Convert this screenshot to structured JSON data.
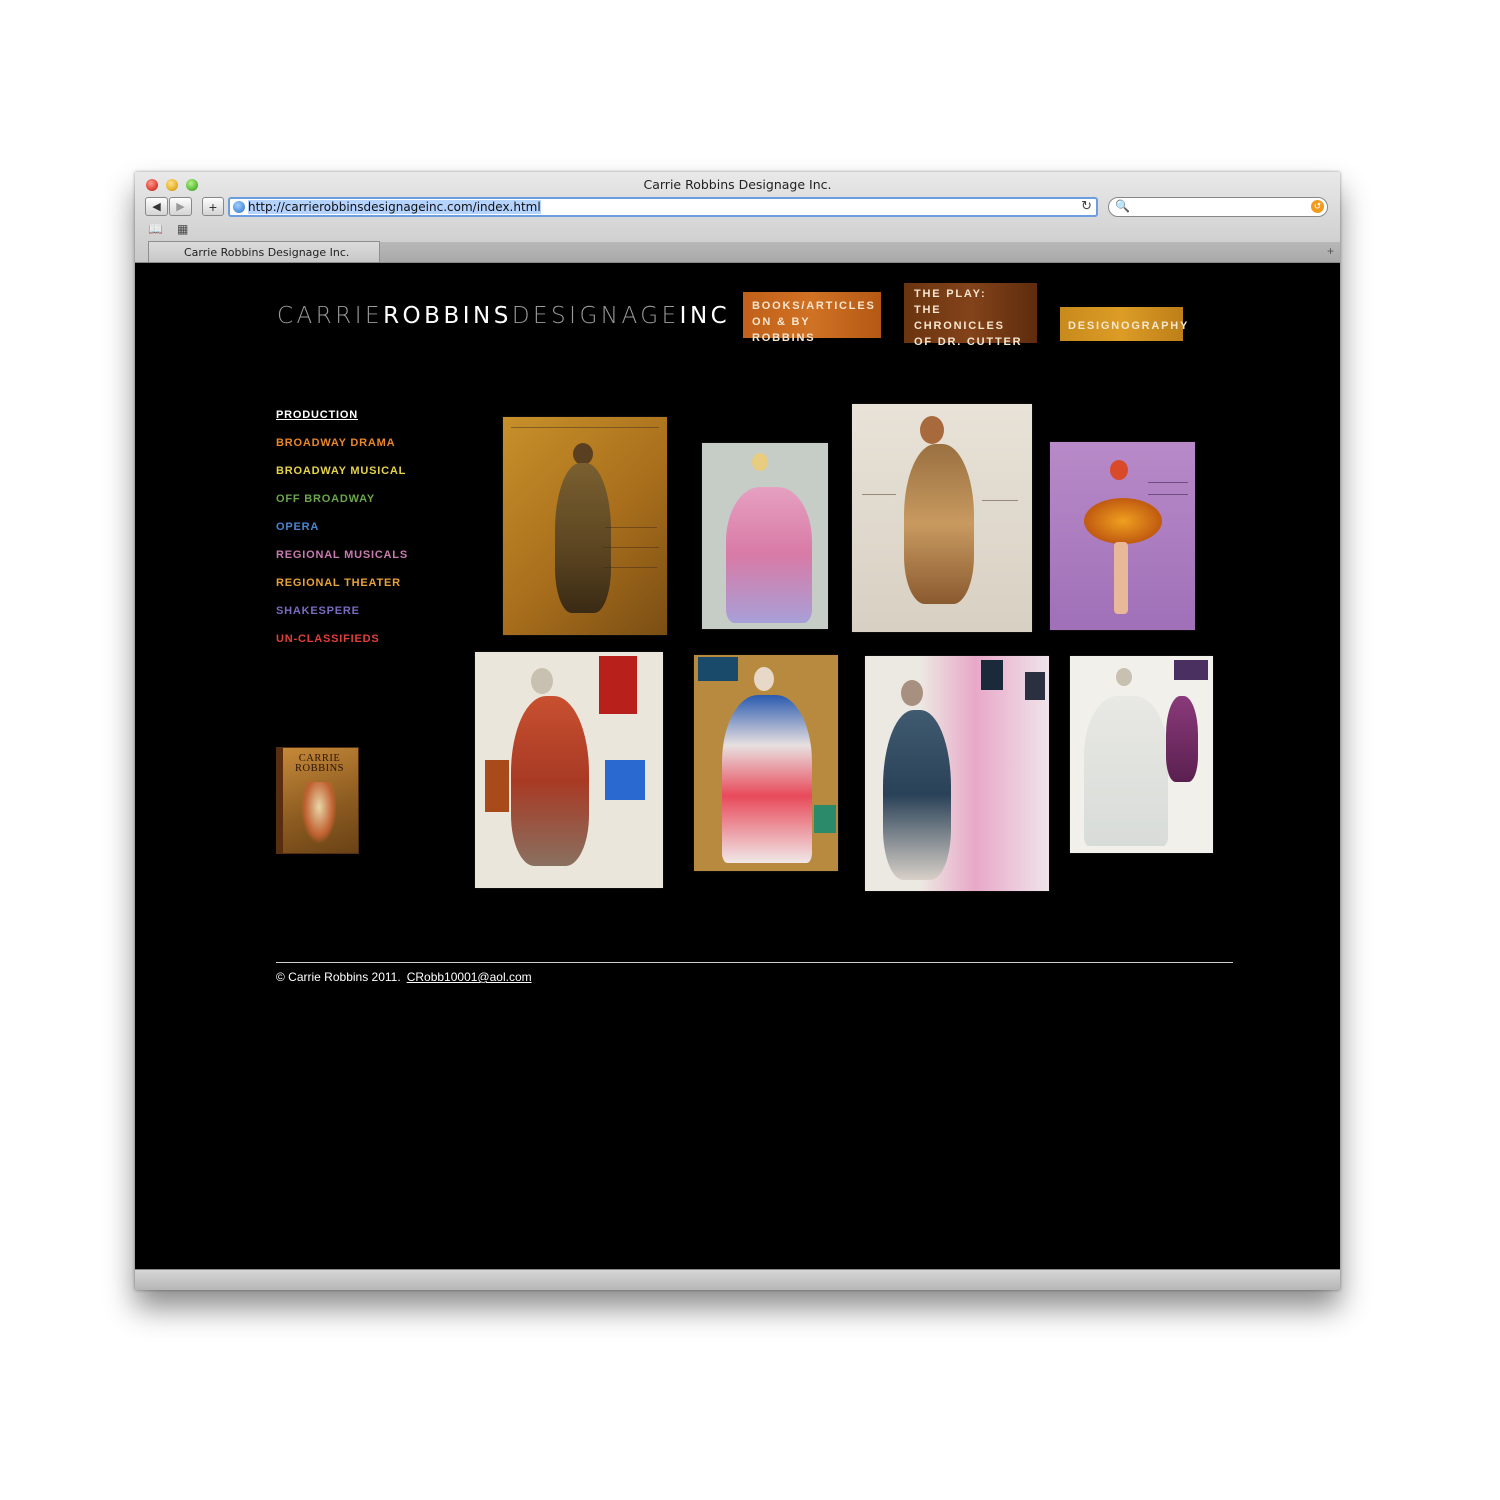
{
  "browser": {
    "window_title": "Carrie Robbins Designage Inc.",
    "url": "http://carrierobbinsdesignageinc.com/index.html",
    "tab_title": "Carrie Robbins Designage Inc.",
    "back_icon": "◀",
    "forward_icon": "▶",
    "add_icon": "+",
    "reload_icon": "↻",
    "search_icon": "🔍",
    "new_tab_icon": "+"
  },
  "site": {
    "logo_parts": [
      "CARRIE",
      "ROBBINS",
      "DESIGNAGE",
      "INC"
    ],
    "top_nav": [
      {
        "label": "BOOKS/ARTICLES\nON & BY ROBBINS",
        "color": "#d07224"
      },
      {
        "label": "THE PLAY:\nTHE CHRONICLES\nOF DR. CUTTER",
        "color": "#83431a"
      },
      {
        "label": "DESIGNOGRAPHY",
        "color": "#dc9c26"
      }
    ],
    "sidebar": {
      "heading": "PRODUCTION",
      "items": [
        {
          "label": "BROADWAY DRAMA",
          "color": "#e8862a"
        },
        {
          "label": "BROADWAY MUSICAL",
          "color": "#e6d34a"
        },
        {
          "label": "OFF BROADWAY",
          "color": "#6aa64a"
        },
        {
          "label": "OPERA",
          "color": "#4a86d0"
        },
        {
          "label": "REGIONAL MUSICALS",
          "color": "#c97ab0"
        },
        {
          "label": "REGIONAL THEATER",
          "color": "#e8a23a"
        },
        {
          "label": "SHAKESPERE",
          "color": "#7a6ac0"
        },
        {
          "label": "UN-CLASSIFIEDS",
          "color": "#e0403a"
        }
      ]
    },
    "book": {
      "cover_title": "CARRIE ROBBINS"
    },
    "footer": {
      "copyright": "© Carrie Robbins 2011.",
      "email": "CRobb10001@aol.com"
    }
  }
}
